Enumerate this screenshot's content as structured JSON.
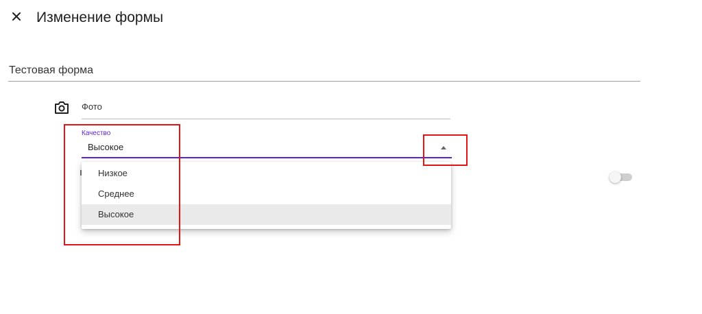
{
  "header": {
    "close_icon": "close-icon",
    "title": "Изменение формы"
  },
  "section": {
    "title": "Тестовая форма"
  },
  "photo_field": {
    "icon": "camera-icon",
    "label": "Фото"
  },
  "quality_select": {
    "label": "Качество",
    "value": "Высокое",
    "arrow_icon": "arrow-up-icon",
    "options": [
      "Низкое",
      "Среднее",
      "Высокое"
    ],
    "selected_option": "Высокое",
    "accent_color": "#5b21d9"
  },
  "toggle": {
    "state": "off"
  },
  "annotations": {
    "highlight_color": "#e31414"
  }
}
